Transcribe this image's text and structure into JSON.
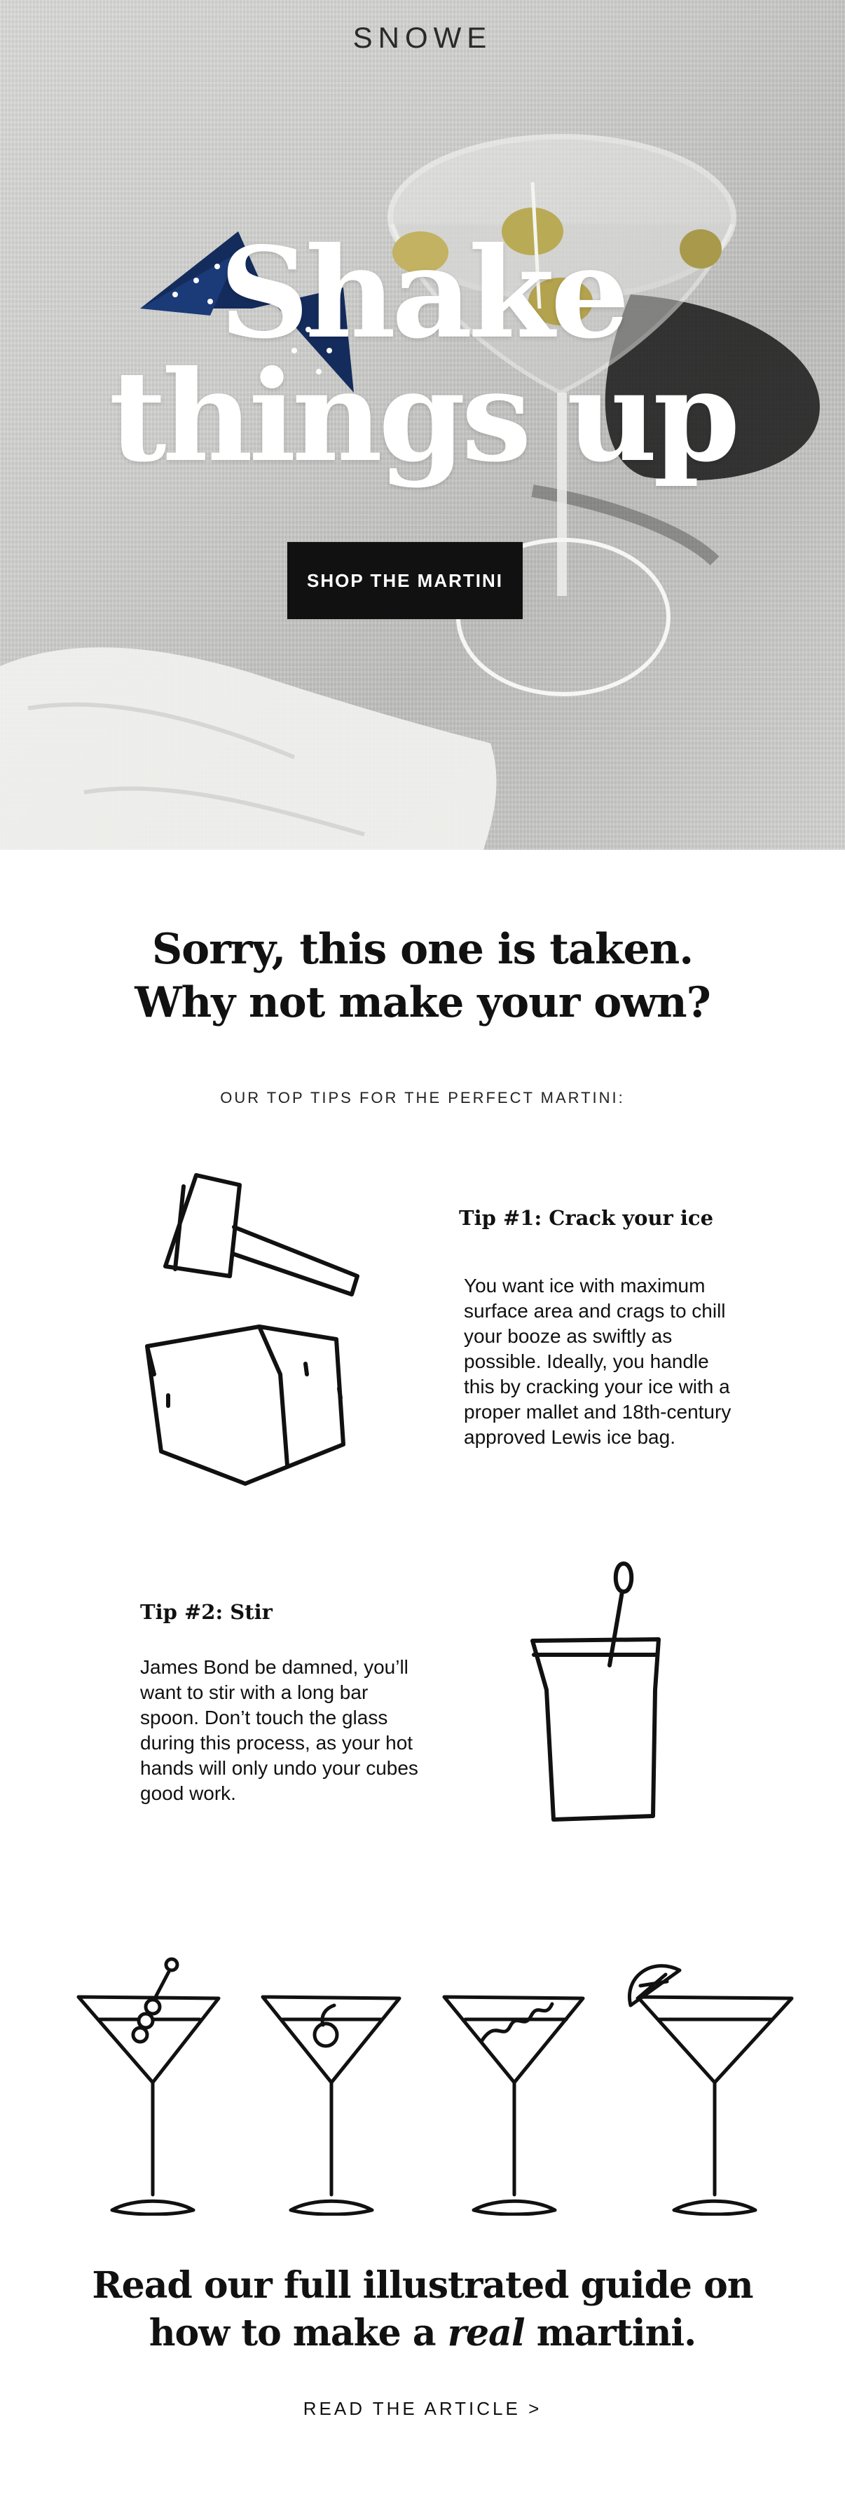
{
  "hero": {
    "brand": "SNOWE",
    "title_line1": "Shake",
    "title_line2": "things up",
    "button_label": "SHOP THE MARTINI"
  },
  "intro": {
    "heading_line1": "Sorry, this one is taken.",
    "heading_line2": "Why not make your own?",
    "tips_label": "OUR TOP TIPS FOR THE PERFECT MARTINI:"
  },
  "tips": [
    {
      "heading": "Tip #1: Crack your ice",
      "body": [
        "You want ice with maximum",
        "surface area and crags to chill",
        "your booze as swiftly as",
        "possible. Ideally, you handle",
        "this by cracking your ice with a",
        "proper mallet and 18th-century",
        "approved Lewis ice bag."
      ]
    },
    {
      "heading": "Tip #2: Stir",
      "body": [
        "James Bond be damned, you’ll",
        "want to stir with a long bar",
        "spoon. Don’t touch the glass",
        "during this process, as your hot",
        "hands will only undo your cubes",
        "good work."
      ]
    }
  ],
  "guide": {
    "line1": "Read our full illustrated guide  on",
    "line2_before": "how to make a ",
    "line2_em": "real",
    "line2_after": " martini.",
    "link": "READ THE ARTICLE >"
  }
}
